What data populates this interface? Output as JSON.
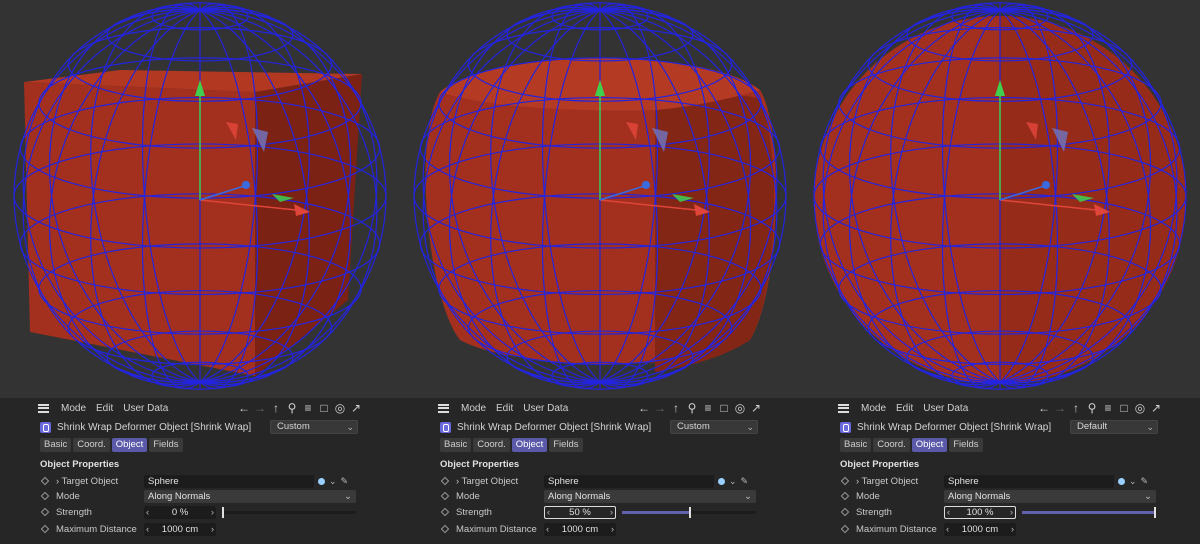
{
  "panels": [
    {
      "menu": {
        "mode": "Mode",
        "edit": "Edit",
        "user_data": "User Data"
      },
      "object_title": "Shrink Wrap Deformer Object [Shrink Wrap]",
      "preset": "Custom",
      "tabs": [
        "Basic",
        "Coord.",
        "Object",
        "Fields"
      ],
      "active_tab": "Object",
      "section_title": "Object Properties",
      "props": {
        "target_label": "Target Object",
        "target_value": "Sphere",
        "mode_label": "Mode",
        "mode_value": "Along Normals",
        "strength_label": "Strength",
        "strength_value": "0 %",
        "strength_fraction": 0.0,
        "maxdist_label": "Maximum Distance",
        "maxdist_value": "1000 cm"
      }
    },
    {
      "menu": {
        "mode": "Mode",
        "edit": "Edit",
        "user_data": "User Data"
      },
      "object_title": "Shrink Wrap Deformer Object [Shrink Wrap]",
      "preset": "Custom",
      "tabs": [
        "Basic",
        "Coord.",
        "Object",
        "Fields"
      ],
      "active_tab": "Object",
      "section_title": "Object Properties",
      "props": {
        "target_label": "Target Object",
        "target_value": "Sphere",
        "mode_label": "Mode",
        "mode_value": "Along Normals",
        "strength_label": "Strength",
        "strength_value": "50 %",
        "strength_fraction": 0.5,
        "maxdist_label": "Maximum Distance",
        "maxdist_value": "1000 cm"
      }
    },
    {
      "menu": {
        "mode": "Mode",
        "edit": "Edit",
        "user_data": "User Data"
      },
      "object_title": "Shrink Wrap Deformer Object [Shrink Wrap]",
      "preset": "Default",
      "tabs": [
        "Basic",
        "Coord.",
        "Object",
        "Fields"
      ],
      "active_tab": "Object",
      "section_title": "Object Properties",
      "props": {
        "target_label": "Target Object",
        "target_value": "Sphere",
        "mode_label": "Mode",
        "mode_value": "Along Normals",
        "strength_label": "Strength",
        "strength_value": "100 %",
        "strength_fraction": 1.0,
        "maxdist_label": "Maximum Distance",
        "maxdist_value": "1000 cm"
      }
    }
  ],
  "icons": [
    "hamburger-icon",
    "back-arrow-icon",
    "forward-arrow-icon",
    "up-arrow-icon",
    "search-icon",
    "filter-icon",
    "lock-icon",
    "target-icon",
    "new-window-icon",
    "shrink-wrap-icon",
    "chevron-down-icon",
    "pick-icon"
  ],
  "colors": {
    "mesh_red": "#a8321f",
    "wire_blue": "#2a2ae6",
    "accent": "#5a5aa8",
    "axis_y": "#3fd04f",
    "axis_x": "#e0453a",
    "axis_z": "#3a6ae0"
  }
}
